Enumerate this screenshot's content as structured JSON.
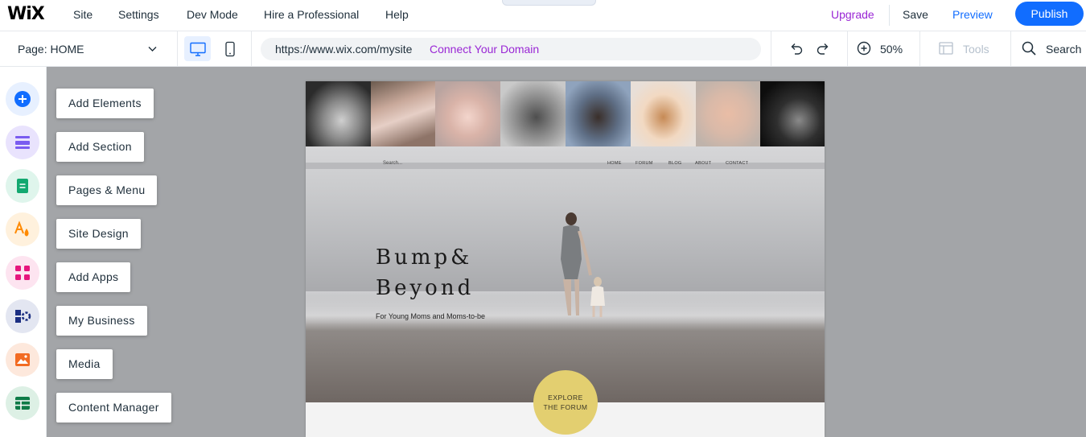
{
  "topbar": {
    "logo": "WiX",
    "menu": [
      {
        "label": "Site"
      },
      {
        "label": "Settings"
      },
      {
        "label": "Dev Mode"
      },
      {
        "label": "Hire a Professional"
      },
      {
        "label": "Help"
      }
    ],
    "upgrade": "Upgrade",
    "save": "Save",
    "preview": "Preview",
    "publish": "Publish"
  },
  "toolbar": {
    "page_label": "Page: HOME",
    "url": "https://www.wix.com/mysite",
    "connect_domain": "Connect Your Domain",
    "zoom": "50%",
    "tools": "Tools",
    "search": "Search"
  },
  "left_panel": {
    "items": [
      {
        "label": "Add Elements",
        "icon": "plus-icon",
        "color": "#116dff"
      },
      {
        "label": "Add Section",
        "icon": "section-icon",
        "color": "#7a5cf0"
      },
      {
        "label": "Pages & Menu",
        "icon": "page-icon",
        "color": "#12a870"
      },
      {
        "label": "Site Design",
        "icon": "design-icon",
        "color": "#ff8a00"
      },
      {
        "label": "Add Apps",
        "icon": "apps-icon",
        "color": "#e6157d"
      },
      {
        "label": "My Business",
        "icon": "business-icon",
        "color": "#1c2f82"
      },
      {
        "label": "Media",
        "icon": "media-icon",
        "color": "#f26b22"
      },
      {
        "label": "Content Manager",
        "icon": "cms-icon",
        "color": "#0f7b48"
      }
    ]
  },
  "site": {
    "nav_search": "Search...",
    "nav": [
      "HOME",
      "FORUM",
      "BLOG",
      "ABOUT",
      "CONTACT"
    ],
    "brand_line1": "Bump&",
    "brand_line2": "Beyond",
    "tagline": "For Young Moms and Moms-to-be",
    "cta_line1": "EXPLORE",
    "cta_line2": "THE FORUM"
  },
  "colors": {
    "accent": "#116dff",
    "upgrade": "#9a27d5",
    "canvas": "#a3a5a8",
    "cta": "#e3cf70"
  }
}
